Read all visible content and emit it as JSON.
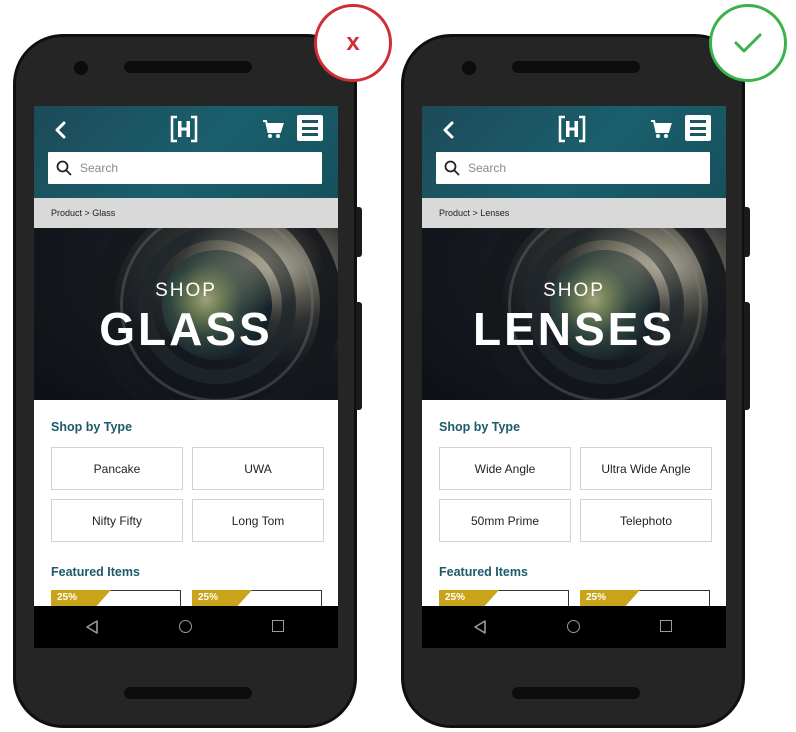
{
  "verdicts": {
    "wrong_mark": "x",
    "correct_mark_icon": "checkmark-icon",
    "wrong_color": "#cf2e36",
    "correct_color": "#3ab34a"
  },
  "phones": [
    {
      "app": {
        "search_placeholder": "Search",
        "breadcrumb": "Product > Glass",
        "hero_shop": "SHOP",
        "hero_title": "GLASS",
        "shop_by_type_heading": "Shop by Type",
        "types": [
          "Pancake",
          "UWA",
          "Nifty Fifty",
          "Long Tom"
        ],
        "featured_heading": "Featured Items",
        "featured_badges": [
          "25%",
          "25%"
        ]
      }
    },
    {
      "app": {
        "search_placeholder": "Search",
        "breadcrumb": "Product > Lenses",
        "hero_shop": "SHOP",
        "hero_title": "LENSES",
        "shop_by_type_heading": "Shop by Type",
        "types": [
          "Wide Angle",
          "Ultra Wide Angle",
          "50mm Prime",
          "Telephoto"
        ],
        "featured_heading": "Featured Items",
        "featured_badges": [
          "25%",
          "25%"
        ]
      }
    }
  ],
  "theme": {
    "header_color": "#1d5563",
    "accent_text": "#1c5a6a",
    "badge_color": "#c9a41a"
  }
}
